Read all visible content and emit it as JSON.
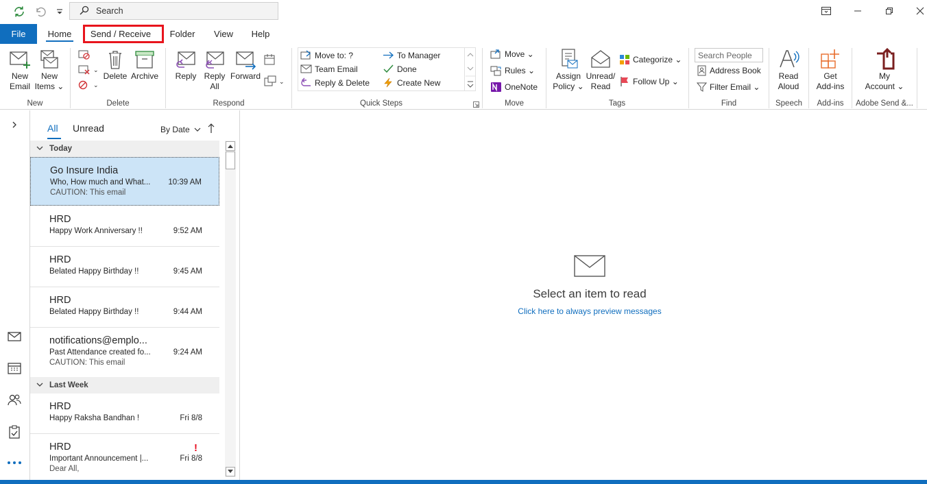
{
  "quick_access": {
    "search_placeholder": "Search"
  },
  "menu": {
    "file": "File",
    "tabs": [
      "Home",
      "Send / Receive",
      "Folder",
      "View",
      "Help"
    ]
  },
  "ribbon": {
    "new_group": {
      "label": "New",
      "new_email": [
        "New",
        "Email"
      ],
      "new_items": [
        "New",
        "Items"
      ]
    },
    "delete_group": {
      "label": "Delete",
      "delete": "Delete",
      "archive": "Archive"
    },
    "respond_group": {
      "label": "Respond",
      "reply": "Reply",
      "reply_all": [
        "Reply",
        "All"
      ],
      "forward": "Forward"
    },
    "quick_steps_group": {
      "label": "Quick Steps",
      "items": [
        "Move to: ?",
        "To Manager",
        "Team Email",
        "Done",
        "Reply & Delete",
        "Create New"
      ]
    },
    "move_group": {
      "label": "Move",
      "move": "Move",
      "rules": "Rules",
      "onenote": "OneNote"
    },
    "tags_group": {
      "label": "Tags",
      "assign_policy": [
        "Assign",
        "Policy"
      ],
      "unread_read": [
        "Unread/",
        "Read"
      ],
      "categorize": "Categorize",
      "follow_up": "Follow Up"
    },
    "find_group": {
      "label": "Find",
      "search_people_placeholder": "Search People",
      "address_book": "Address Book",
      "filter_email": "Filter Email"
    },
    "speech_group": {
      "label": "Speech",
      "read_aloud": [
        "Read",
        "Aloud"
      ]
    },
    "addins_group": {
      "label": "Add-ins",
      "get_addins": [
        "Get",
        "Add-ins"
      ]
    },
    "adobe_group": {
      "label": "Adobe Send &...",
      "my_account": [
        "My",
        "Account"
      ]
    }
  },
  "message_list": {
    "filter_all": "All",
    "filter_unread": "Unread",
    "sort_label": "By Date",
    "groups": [
      {
        "header": "Today",
        "items": [
          {
            "sender": "Go Insure India",
            "subject": "Who, How much and What...",
            "time": "10:39 AM",
            "preview": "CAUTION: This email",
            "selected": true
          },
          {
            "sender": "HRD",
            "subject": "Happy Work Anniversary !!",
            "time": "9:52 AM",
            "preview": ""
          },
          {
            "sender": "HRD",
            "subject": "Belated Happy Birthday !!",
            "time": "9:45 AM",
            "preview": ""
          },
          {
            "sender": "HRD",
            "subject": "Belated Happy Birthday !!",
            "time": "9:44 AM",
            "preview": ""
          },
          {
            "sender": "notifications@emplo...",
            "subject": "Past Attendance created fo...",
            "time": "9:24 AM",
            "preview": "CAUTION: This email"
          }
        ]
      },
      {
        "header": "Last Week",
        "items": [
          {
            "sender": "HRD",
            "subject": "Happy Raksha Bandhan !",
            "time": "Fri 8/8",
            "preview": ""
          },
          {
            "sender": "HRD",
            "subject": "Important Announcement |...",
            "time": "Fri 8/8",
            "preview": "Dear All,",
            "important_mark": "!"
          }
        ]
      }
    ]
  },
  "reading_pane": {
    "title": "Select an item to read",
    "link": "Click here to always preview messages"
  },
  "colors": {
    "accent": "#106ebe",
    "selected_row": "#cce4f7",
    "highlight_box": "#e8141c"
  }
}
